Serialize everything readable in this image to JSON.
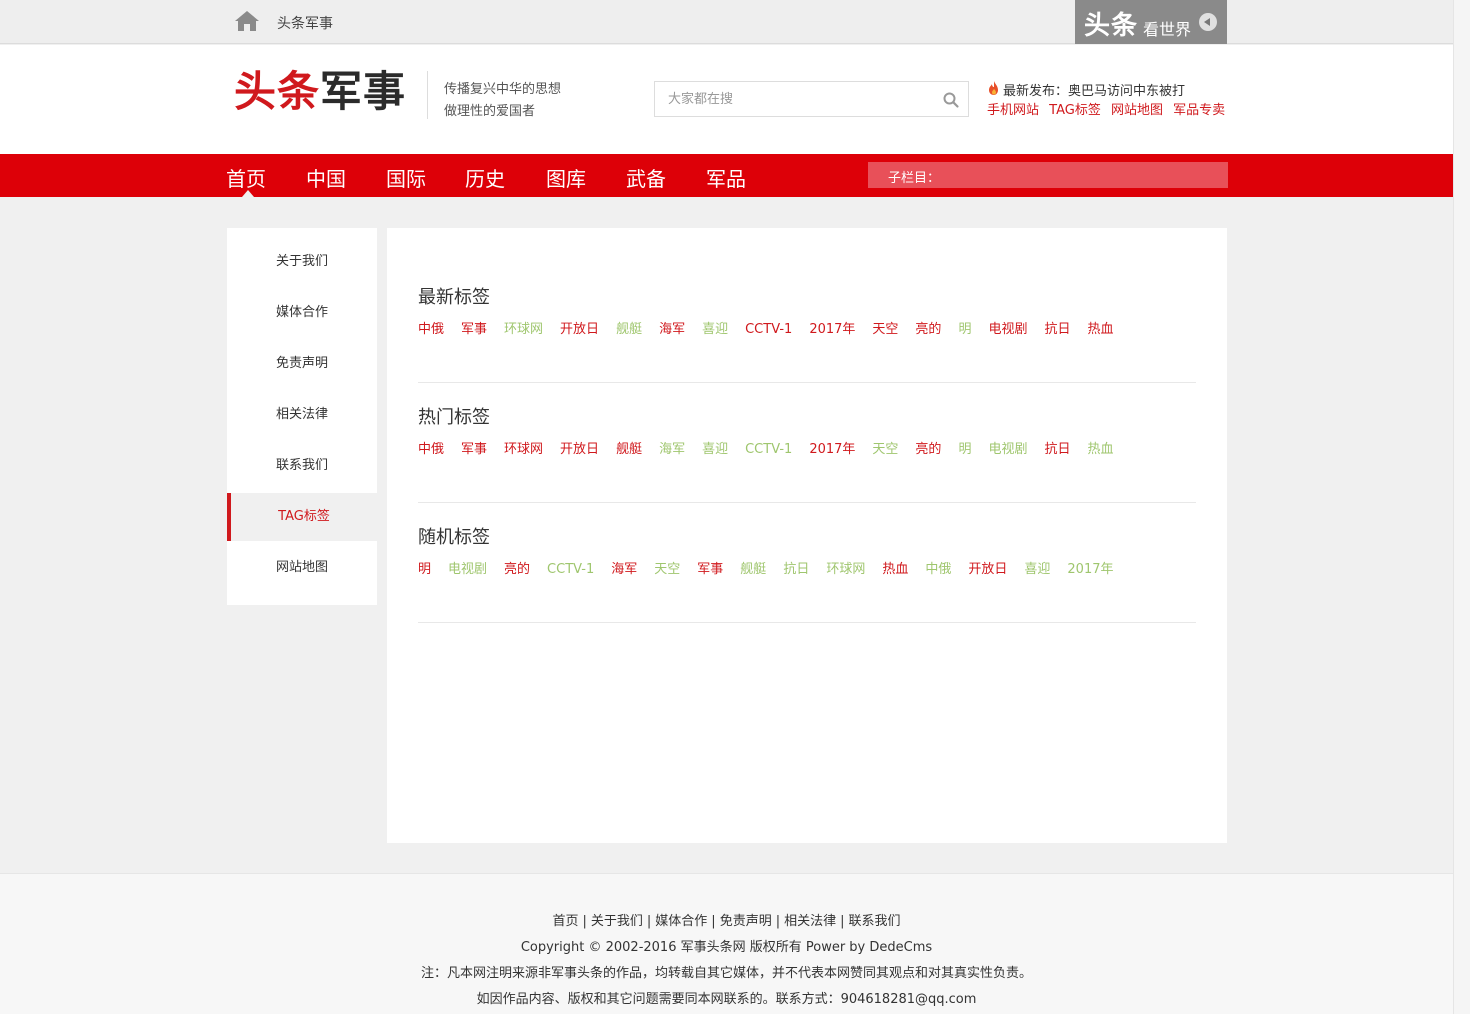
{
  "topbar": {
    "site_name": "头条军事",
    "promo_big": "头条",
    "promo_small": "看世界"
  },
  "header": {
    "logo_part1": "头条",
    "logo_part2": "军事",
    "slogan_line1": "传播复兴中华的思想",
    "slogan_line2": "做理性的爱国者",
    "search_placeholder": "大家都在搜",
    "latest_prefix": "最新发布：奥巴马访问中东被打",
    "quick_links": [
      "手机网站",
      "TAG标签",
      "网站地图",
      "军品专卖"
    ]
  },
  "nav": {
    "items": [
      "首页",
      "中国",
      "国际",
      "历史",
      "图库",
      "武备",
      "军品"
    ],
    "subcolumn_label": "子栏目："
  },
  "sidebar": {
    "items": [
      "关于我们",
      "媒体合作",
      "免责声明",
      "相关法律",
      "联系我们",
      "TAG标签",
      "网站地图"
    ],
    "active_index": 5
  },
  "colors": {
    "accent_red": "#d0191d",
    "nav_red": "#dd0008",
    "tag_red": "#d0191d",
    "tag_green": "#9fc66e"
  },
  "sections": [
    {
      "title": "最新标签",
      "tags": [
        {
          "text": "中俄",
          "color": "red"
        },
        {
          "text": "军事",
          "color": "red"
        },
        {
          "text": "环球网",
          "color": "green"
        },
        {
          "text": "开放日",
          "color": "red"
        },
        {
          "text": "舰艇",
          "color": "green"
        },
        {
          "text": "海军",
          "color": "red"
        },
        {
          "text": "喜迎",
          "color": "green"
        },
        {
          "text": "CCTV-1",
          "color": "red"
        },
        {
          "text": "2017年",
          "color": "red"
        },
        {
          "text": "天空",
          "color": "red"
        },
        {
          "text": "亮的",
          "color": "red"
        },
        {
          "text": "明",
          "color": "green"
        },
        {
          "text": "电视剧",
          "color": "red"
        },
        {
          "text": "抗日",
          "color": "red"
        },
        {
          "text": "热血",
          "color": "red"
        }
      ]
    },
    {
      "title": "热门标签",
      "tags": [
        {
          "text": "中俄",
          "color": "red"
        },
        {
          "text": "军事",
          "color": "red"
        },
        {
          "text": "环球网",
          "color": "red"
        },
        {
          "text": "开放日",
          "color": "red"
        },
        {
          "text": "舰艇",
          "color": "red"
        },
        {
          "text": "海军",
          "color": "green"
        },
        {
          "text": "喜迎",
          "color": "green"
        },
        {
          "text": "CCTV-1",
          "color": "green"
        },
        {
          "text": "2017年",
          "color": "red"
        },
        {
          "text": "天空",
          "color": "green"
        },
        {
          "text": "亮的",
          "color": "red"
        },
        {
          "text": "明",
          "color": "green"
        },
        {
          "text": "电视剧",
          "color": "green"
        },
        {
          "text": "抗日",
          "color": "red"
        },
        {
          "text": "热血",
          "color": "green"
        }
      ]
    },
    {
      "title": "随机标签",
      "tags": [
        {
          "text": "明",
          "color": "red"
        },
        {
          "text": "电视剧",
          "color": "green"
        },
        {
          "text": "亮的",
          "color": "red"
        },
        {
          "text": "CCTV-1",
          "color": "green"
        },
        {
          "text": "海军",
          "color": "red"
        },
        {
          "text": "天空",
          "color": "green"
        },
        {
          "text": "军事",
          "color": "red"
        },
        {
          "text": "舰艇",
          "color": "green"
        },
        {
          "text": "抗日",
          "color": "green"
        },
        {
          "text": "环球网",
          "color": "green"
        },
        {
          "text": "热血",
          "color": "red"
        },
        {
          "text": "中俄",
          "color": "green"
        },
        {
          "text": "开放日",
          "color": "red"
        },
        {
          "text": "喜迎",
          "color": "green"
        },
        {
          "text": "2017年",
          "color": "green"
        }
      ]
    }
  ],
  "footer": {
    "links": [
      "首页",
      "关于我们",
      "媒体合作",
      "免责声明",
      "相关法律",
      "联系我们"
    ],
    "copyright": "Copyright © 2002-2016 军事头条网 版权所有 Power by DedeCms",
    "note": "注：凡本网注明来源非军事头条的作品，均转载自其它媒体，并不代表本网赞同其观点和对其真实性负责。",
    "contact": "如因作品内容、版权和其它问题需要同本网联系的。联系方式：904618281@qq.com"
  }
}
